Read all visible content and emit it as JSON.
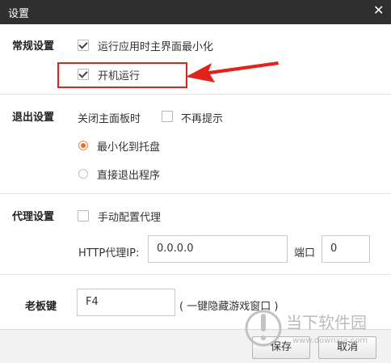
{
  "window": {
    "title": "设置",
    "close_glyph": "✕"
  },
  "general": {
    "label": "常规设置",
    "minimize_on_run": {
      "label": "运行应用时主界面最小化",
      "checked": true
    },
    "autostart": {
      "label": "开机运行",
      "checked": true
    }
  },
  "exit": {
    "label": "退出设置",
    "close_panel_label": "关闭主面板时",
    "no_prompt": {
      "label": "不再提示",
      "checked": false
    },
    "options": [
      {
        "label": "最小化到托盘",
        "selected": true
      },
      {
        "label": "直接退出程序",
        "selected": false
      }
    ]
  },
  "proxy": {
    "label": "代理设置",
    "manual": {
      "label": "手动配置代理",
      "checked": false
    },
    "http_ip_label": "HTTP代理IP:",
    "http_ip_value": "0.0.0.0",
    "port_label": "端口",
    "port_value": "0"
  },
  "boss_key": {
    "label": "老板键",
    "value": "F4",
    "hint": "( 一键隐藏游戏窗口 )"
  },
  "buttons": {
    "save": "保存",
    "cancel": "取消"
  },
  "watermark": {
    "brand": "当下软件园",
    "url": "www.downxia.com"
  },
  "colors": {
    "accent": "#f26c22",
    "annotation": "#e2231a",
    "titlebar": "#2f2f2f"
  }
}
